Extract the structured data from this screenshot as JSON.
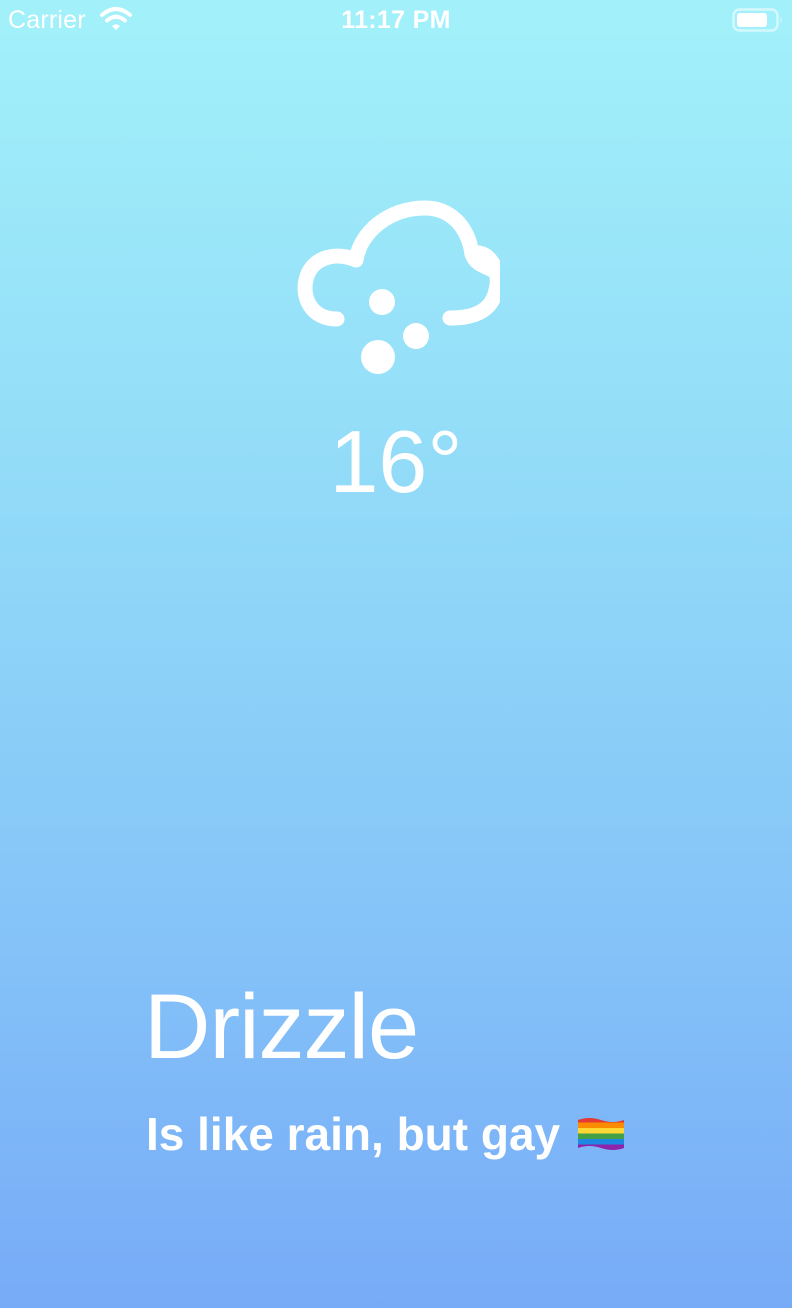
{
  "status_bar": {
    "carrier": "Carrier",
    "time": "11:17 PM",
    "icons": [
      "wifi-icon",
      "battery-icon"
    ]
  },
  "weather": {
    "icon": "drizzle-cloud-icon",
    "temperature": "16°",
    "condition": "Drizzle",
    "description": "Is like rain, but gay",
    "description_emoji_icon": "rainbow-flag-icon"
  },
  "colors": {
    "gradient_top": "#a2f1fa",
    "gradient_bottom": "#77abf7",
    "text": "#ffffff"
  }
}
